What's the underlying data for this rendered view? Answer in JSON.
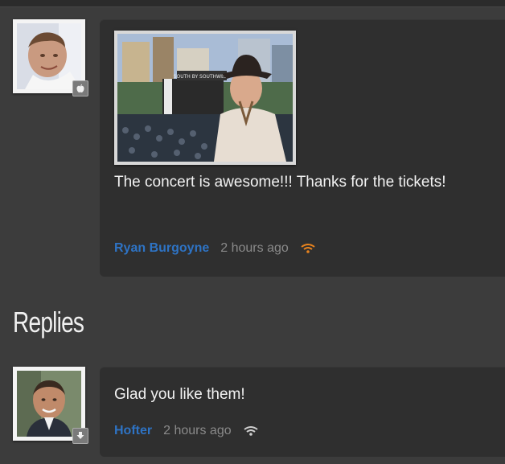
{
  "post": {
    "text": "The concert is awesome!!! Thanks for the tickets!",
    "author": "Ryan Burgoyne",
    "time": "2 hours ago",
    "photo_banner": "SOUTH BY SOUTHWEST"
  },
  "replies_heading": "Replies",
  "reply": {
    "text": "Glad you like them!",
    "author": "Hofter",
    "time": "2 hours ago"
  },
  "colors": {
    "background": "#3c3c3c",
    "card": "#2f2f2f",
    "author_link": "#2e73c4",
    "signal_active": "#e8831e",
    "signal_idle": "#cfcfcf"
  },
  "icons": {
    "post_badge": "apple-icon",
    "reply_badge": "download-icon",
    "post_signal": "wifi-signal-icon",
    "reply_signal": "wifi-signal-icon"
  }
}
